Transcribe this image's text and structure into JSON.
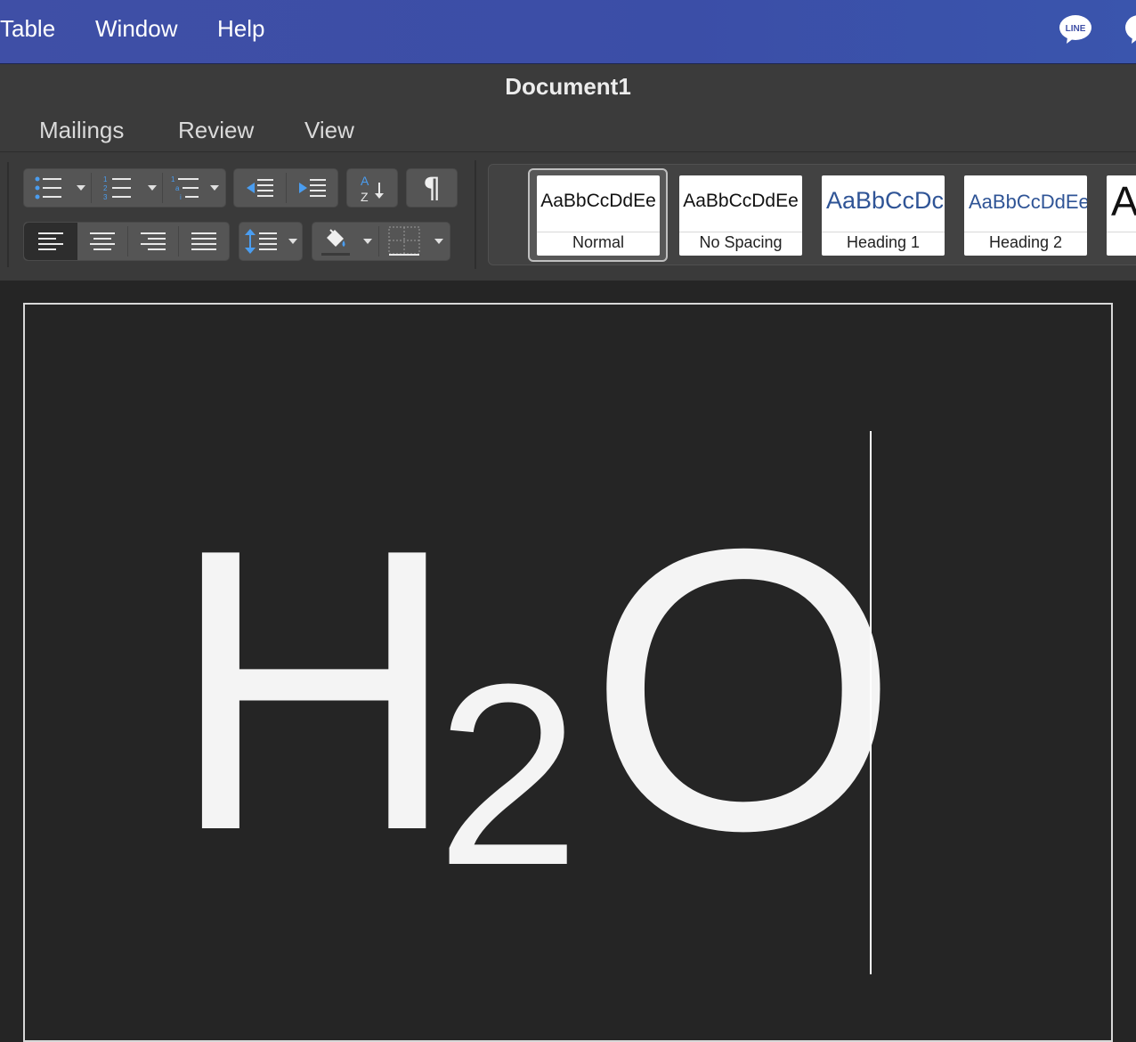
{
  "menubar": {
    "items": [
      "Table",
      "Window",
      "Help"
    ],
    "tray_icon": "line-app-icon",
    "tray_icon_label": "LINE"
  },
  "window": {
    "title": "Document1"
  },
  "ribbon_tabs": [
    "Mailings",
    "Review",
    "View"
  ],
  "toolbar": {
    "icons": [
      "bullets-icon",
      "numbering-icon",
      "multilevel-list-icon",
      "decrease-indent-icon",
      "increase-indent-icon",
      "sort-icon",
      "show-formatting-icon",
      "align-left-icon",
      "align-center-icon",
      "align-right-icon",
      "justify-icon",
      "line-spacing-icon",
      "shading-icon",
      "borders-icon"
    ],
    "sort_label": "AZ",
    "pilcrow": "¶"
  },
  "styles": [
    {
      "sample": "AaBbCcDdEe",
      "name": "Normal"
    },
    {
      "sample": "AaBbCcDdEe",
      "name": "No Spacing"
    },
    {
      "sample": "AaBbCcDc",
      "name": "Heading 1"
    },
    {
      "sample": "AaBbCcDdEe",
      "name": "Heading 2"
    },
    {
      "sample": "A",
      "name": ""
    }
  ],
  "document": {
    "formula_main": "H",
    "formula_sub": "2",
    "formula_end": "O"
  },
  "colors": {
    "menubar": "#3f4fa6",
    "ribbon": "#3a3a3a",
    "heading_text": "#2f5496",
    "page": "#252525"
  }
}
